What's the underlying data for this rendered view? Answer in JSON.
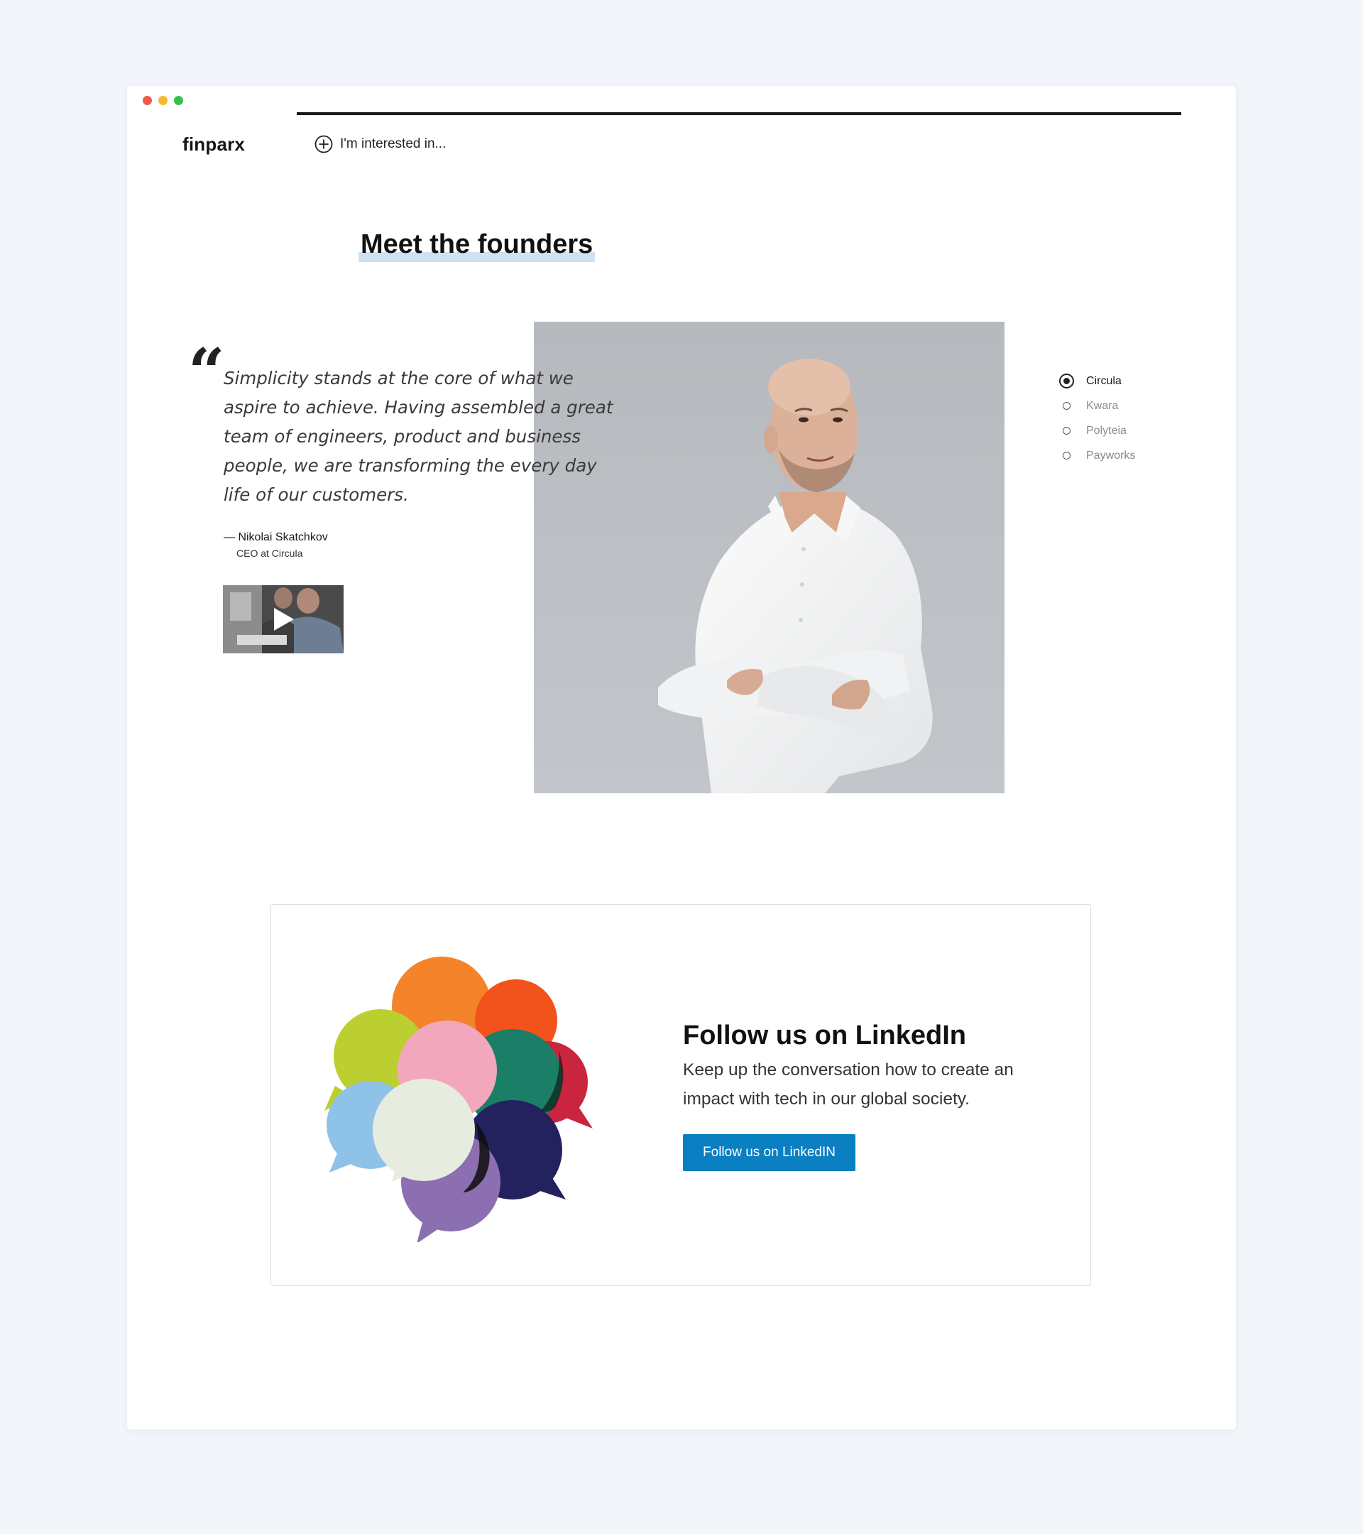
{
  "brand": {
    "logo_text": "finparx"
  },
  "nav": {
    "interest_label": "I'm interested in..."
  },
  "founders": {
    "heading": "Meet the founders",
    "quote": "Simplicity stands at the core of what we aspire to achieve. Having assembled a great team of engineers, product and business people, we are transforming the every day life of our customers.",
    "author": "— Nikolai Skatchkov",
    "author_role": "CEO at Circula"
  },
  "companies": [
    {
      "label": "Circula",
      "active": true
    },
    {
      "label": "Kwara",
      "active": false
    },
    {
      "label": "Polyteia",
      "active": false
    },
    {
      "label": "Payworks",
      "active": false
    }
  ],
  "linkedin": {
    "title": "Follow us on LinkedIn",
    "text": "Keep up the conversation how to create an impact with tech in our global society.",
    "button_label": "Follow us on LinkedIN"
  },
  "colors": {
    "accent": "#0a7fc2",
    "heading_highlight": "#cfe1f3",
    "page_background": "#f2f6fa"
  }
}
